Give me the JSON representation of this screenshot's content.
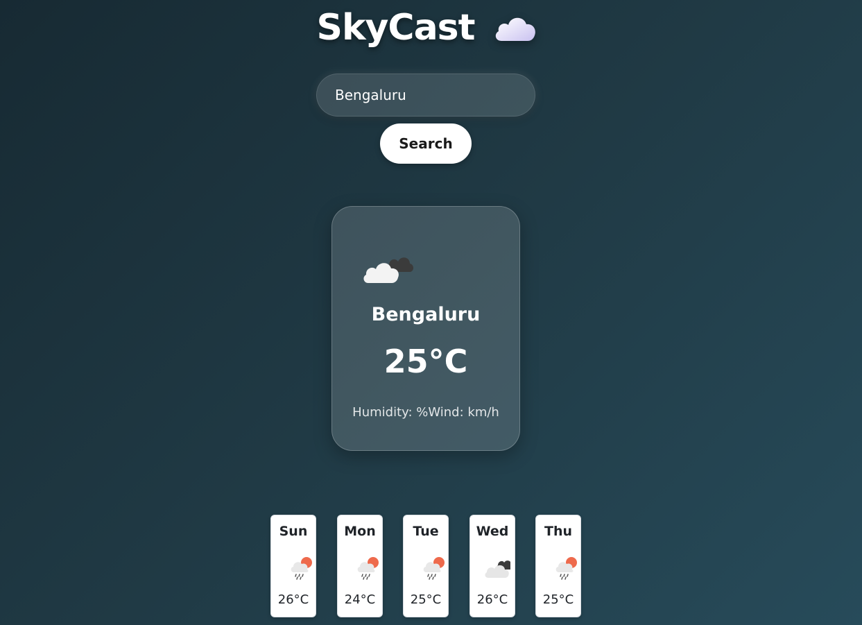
{
  "app": {
    "title": "SkyCast",
    "title_icon": "cloud-icon"
  },
  "search": {
    "value": "Bengaluru",
    "placeholder": "",
    "button_label": "Search"
  },
  "current": {
    "icon": "partly-cloudy-icon",
    "city": "Bengaluru",
    "temperature": "25°C",
    "details": "Humidity: %Wind: km/h"
  },
  "forecast": [
    {
      "day": "Sun",
      "temp": "26°C",
      "icon": "sun-rain-icon"
    },
    {
      "day": "Mon",
      "temp": "24°C",
      "icon": "sun-rain-icon"
    },
    {
      "day": "Tue",
      "temp": "25°C",
      "icon": "sun-rain-icon"
    },
    {
      "day": "Wed",
      "temp": "26°C",
      "icon": "cloudy-icon"
    },
    {
      "day": "Thu",
      "temp": "25°C",
      "icon": "sun-rain-icon"
    }
  ],
  "colors": {
    "background_start": "#172a33",
    "background_end": "#274b5a",
    "sun_accent": "#ee6a4c"
  }
}
